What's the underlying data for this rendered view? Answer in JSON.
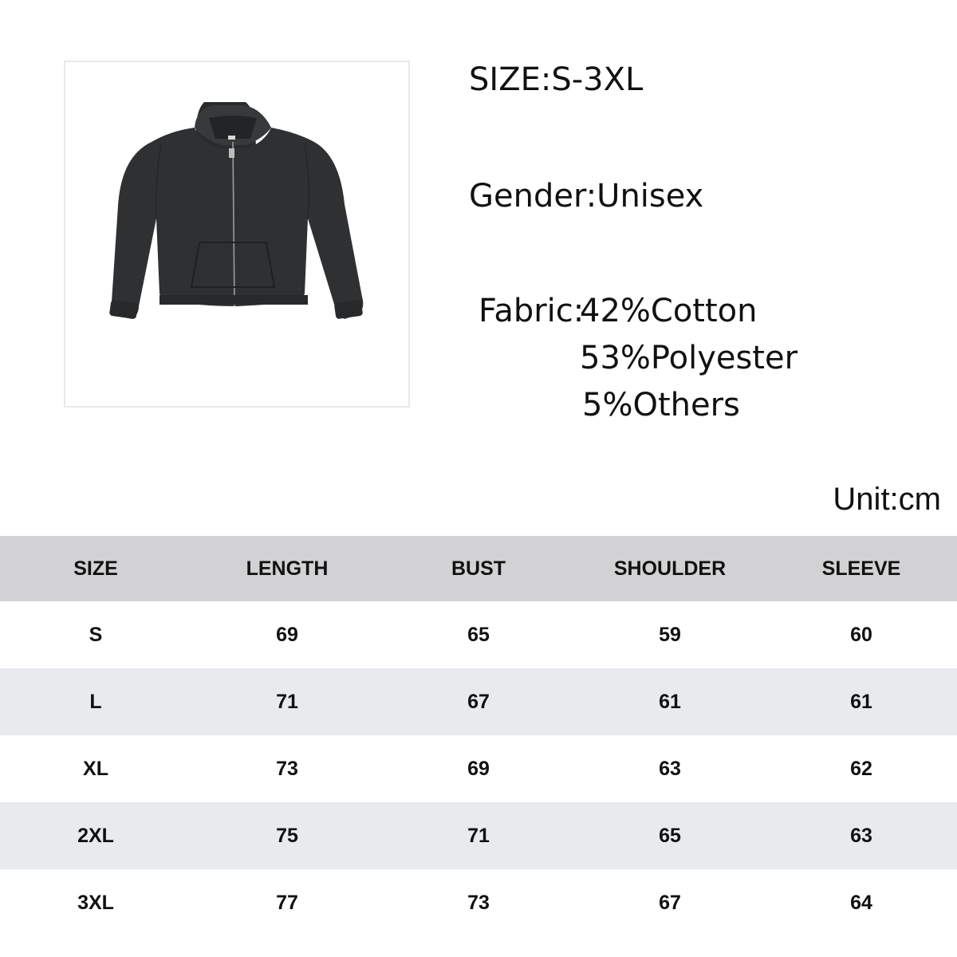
{
  "product": {
    "image_icon": "zip-hoodie-icon",
    "garment_color": "#2d2e30"
  },
  "specs": {
    "size": "SIZE:S-3XL",
    "gender": "Gender:Unisex",
    "fabric_label": "Fabric:",
    "fabric_lines": [
      "42%Cotton",
      "53%Polyester",
      "5%Others"
    ]
  },
  "unit": "Unit:cm",
  "table": {
    "headers": [
      "SIZE",
      "LENGTH",
      "BUST",
      "SHOULDER",
      "SLEEVE"
    ],
    "rows": [
      [
        "S",
        "69",
        "65",
        "59",
        "60"
      ],
      [
        "L",
        "71",
        "67",
        "61",
        "61"
      ],
      [
        "XL",
        "73",
        "69",
        "63",
        "62"
      ],
      [
        "2XL",
        "75",
        "71",
        "65",
        "63"
      ],
      [
        "3XL",
        "77",
        "73",
        "67",
        "64"
      ]
    ],
    "header_bg": "#d2d2d4",
    "stripe_bg": "#e9eaee"
  }
}
